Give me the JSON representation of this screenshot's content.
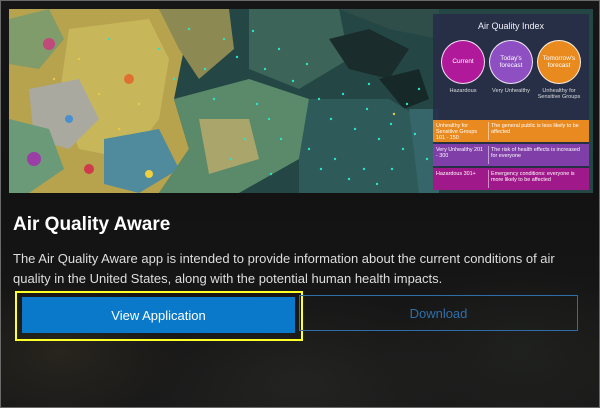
{
  "card": {
    "title": "Air Quality Aware",
    "description": "The Air Quality Aware app is intended to provide information about the current conditions of air quality in the United States, along with the potential human health impacts.",
    "view_button": "View Application",
    "download_button": "Download"
  },
  "legend": {
    "title": "Air Quality Index",
    "circles": [
      {
        "label": "Current",
        "caption": "Hazardous",
        "color": "#b01a9a"
      },
      {
        "label": "Today's forecast",
        "caption": "Very Unhealthy",
        "color": "#8e4fc2"
      },
      {
        "label": "Tomorrow's forecast",
        "caption": "Unhealthy for Sensitive Groups",
        "color": "#e98a1e"
      }
    ],
    "bands": [
      {
        "range": "Unhealthy for Sensitive Groups 101 - 150",
        "text": "The general public is less likely to be affected",
        "color": "#e88a20"
      },
      {
        "range": "Very Unhealthy 201 - 300",
        "text": "The risk of health effects is increased for everyone",
        "color": "#7f3ea8"
      },
      {
        "range": "Hazardous 301+",
        "text": "Emergency conditions: everyone is more likely to be affected",
        "color": "#a0198a"
      }
    ]
  },
  "colors": {
    "accent": "#0a79c9",
    "highlight": "#ffff2a",
    "outline_button": "#2e6ea8"
  }
}
